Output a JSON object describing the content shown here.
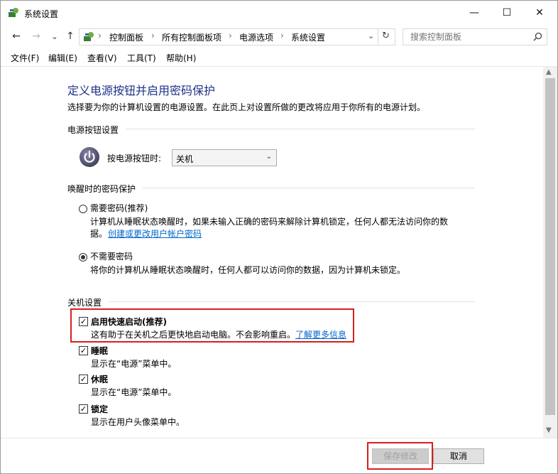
{
  "window": {
    "title": "系统设置",
    "controls": {
      "minimize": "—",
      "maximize": "☐",
      "close": "✕"
    }
  },
  "nav": {
    "back": "←",
    "forward": "→",
    "recent": "⌄",
    "up": "↑",
    "breadcrumb": [
      "控制面板",
      "所有控制面板项",
      "电源选项",
      "系统设置"
    ],
    "search_placeholder": "搜索控制面板"
  },
  "menu": [
    "文件(F)",
    "编辑(E)",
    "查看(V)",
    "工具(T)",
    "帮助(H)"
  ],
  "page": {
    "title": "定义电源按钮并启用密码保护",
    "description": "选择要为你的计算机设置的电源设置。在此页上对设置所做的更改将应用于你所有的电源计划。"
  },
  "power_button": {
    "group_title": "电源按钮设置",
    "label": "按电源按钮时:",
    "selected": "关机"
  },
  "wake_password": {
    "group_title": "唤醒时的密码保护",
    "options": [
      {
        "label": "需要密码(推荐)",
        "desc": "计算机从睡眠状态唤醒时，如果未输入正确的密码来解除计算机锁定，任何人都无法访问你的数",
        "desc2": "据。",
        "link": "创建或更改用户帐户密码",
        "selected": false
      },
      {
        "label": "不需要密码",
        "desc": "将你的计算机从睡眠状态唤醒时，任何人都可以访问你的数据，因为计算机未锁定。",
        "selected": true
      }
    ]
  },
  "shutdown": {
    "group_title": "关机设置",
    "items": [
      {
        "label": "启用快速启动(推荐)",
        "desc": "这有助于在关机之后更快地启动电脑。不会影响重启。",
        "link": "了解更多信息",
        "checked": true
      },
      {
        "label": "睡眠",
        "desc": "显示在“电源”菜单中。",
        "checked": true
      },
      {
        "label": "休眠",
        "desc": "显示在“电源”菜单中。",
        "checked": true
      },
      {
        "label": "锁定",
        "desc": "显示在用户头像菜单中。",
        "checked": true
      }
    ]
  },
  "footer": {
    "save": "保存修改",
    "cancel": "取消"
  },
  "colors": {
    "title_blue": "#1e3287",
    "link_blue": "#0066cc",
    "highlight_red": "#d61f1f"
  },
  "icons": {
    "title": "control-panel-icon",
    "power": "power-icon",
    "search": "search-icon",
    "refresh": "refresh-icon"
  }
}
